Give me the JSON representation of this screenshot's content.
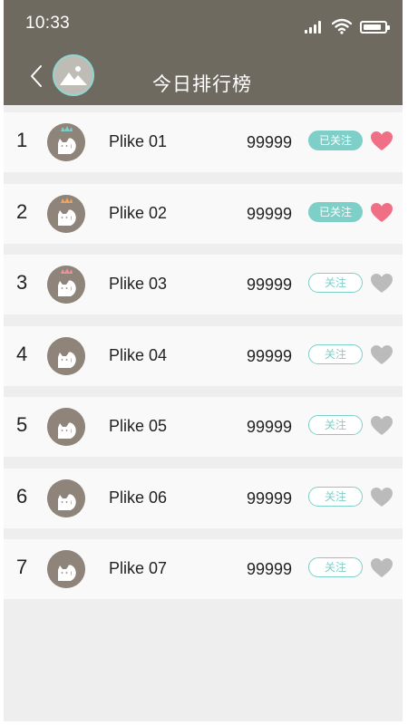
{
  "status_bar": {
    "time": "10:33",
    "battery_level": 0.85
  },
  "header": {
    "title": "今日排行榜",
    "back_icon": "chevron-left-icon",
    "avatar_icon": "image-placeholder-icon"
  },
  "colors": {
    "header_bg": "#6e6a60",
    "accent": "#7ecfc8",
    "heart_active": "#f06f85",
    "heart_inactive": "#bbbbbb",
    "avatar_bg": "#8e847a"
  },
  "rankings": [
    {
      "rank": "1",
      "name": "Plike 01",
      "score": "99999",
      "follow_label": "已关注",
      "followed": true,
      "liked": true,
      "crown_color": "#7ecfc8"
    },
    {
      "rank": "2",
      "name": "Plike 02",
      "score": "99999",
      "follow_label": "已关注",
      "followed": true,
      "liked": true,
      "crown_color": "#f2a35e"
    },
    {
      "rank": "3",
      "name": "Plike 03",
      "score": "99999",
      "follow_label": "关注",
      "followed": false,
      "liked": false,
      "crown_color": "#f08fa0"
    },
    {
      "rank": "4",
      "name": "Plike 04",
      "score": "99999",
      "follow_label": "关注",
      "followed": false,
      "liked": false,
      "crown_color": ""
    },
    {
      "rank": "5",
      "name": "Plike 05",
      "score": "99999",
      "follow_label": "关注",
      "followed": false,
      "liked": false,
      "crown_color": ""
    },
    {
      "rank": "6",
      "name": "Plike 06",
      "score": "99999",
      "follow_label": "关注",
      "followed": false,
      "liked": false,
      "crown_color": ""
    },
    {
      "rank": "7",
      "name": "Plike 07",
      "score": "99999",
      "follow_label": "关注",
      "followed": false,
      "liked": false,
      "crown_color": ""
    }
  ]
}
